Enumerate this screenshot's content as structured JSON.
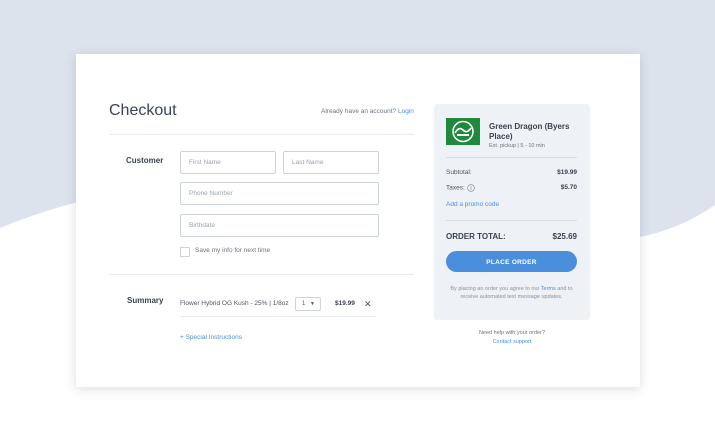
{
  "checkout": {
    "title": "Checkout",
    "account_prompt": "Already have an account?",
    "login_link": "Login"
  },
  "customer": {
    "label": "Customer",
    "first_name_placeholder": "First Name",
    "last_name_placeholder": "Last Name",
    "phone_placeholder": "Phone Number",
    "birthdate_placeholder": "Birthdate",
    "save_info_label": "Save my info for next time"
  },
  "summary": {
    "label": "Summary",
    "items": [
      {
        "name": "Flower Hybrid OG Kush - 25% | 1/8oz",
        "quantity": "1",
        "price": "$19.99"
      }
    ],
    "special_instructions": "+ Special Instructions"
  },
  "order_panel": {
    "store_name": "Green Dragon (Byers Place)",
    "pickup": "Est. pickup | 5 - 10 min",
    "logo_icon": "green-dragon-logo-icon",
    "subtotal_label": "Subtotal:",
    "subtotal_value": "$19.99",
    "taxes_label": "Taxes:",
    "taxes_value": "$5.70",
    "promo_link": "Add a promo code",
    "total_label": "ORDER TOTAL:",
    "total_value": "$25.69",
    "place_order": "PLACE ORDER",
    "legal_pre": "By placing an order you agree to our",
    "legal_terms": "Terms",
    "legal_post": "and to receive automated text message updates.",
    "help_text": "Need help with your order?",
    "contact_support": "Contact support"
  },
  "colors": {
    "accent": "#4a8fdc",
    "brand_green": "#1f8a3c",
    "background_wave": "#dde3ec"
  }
}
